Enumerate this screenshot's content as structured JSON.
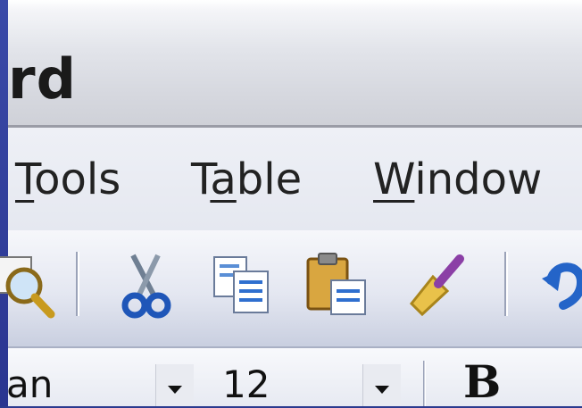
{
  "window": {
    "title_fragment": "rd"
  },
  "menubar": {
    "items": [
      {
        "label_pre": "",
        "label_u": "T",
        "label_post": "ools"
      },
      {
        "label_pre": "T",
        "label_u": "a",
        "label_post": "ble"
      },
      {
        "label_pre": "",
        "label_u": "W",
        "label_post": "indow"
      }
    ]
  },
  "toolbar": {
    "buttons": [
      "print-preview-icon",
      "cut-icon",
      "copy-icon",
      "paste-icon",
      "format-painter-icon",
      "undo-icon"
    ]
  },
  "formatting": {
    "font_name": "an",
    "font_size": "12",
    "bold_label": "B"
  }
}
